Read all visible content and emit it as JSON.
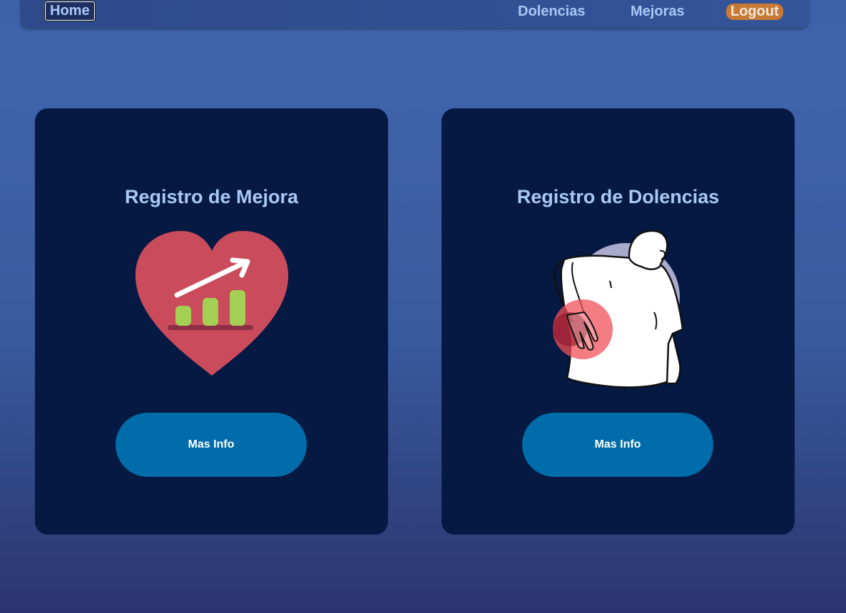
{
  "navbar": {
    "home_label": "Home",
    "dolencias_label": "Dolencias",
    "mejoras_label": "Mejoras",
    "logout_label": "Logout"
  },
  "cards": [
    {
      "title": "Registro de Mejora",
      "button_label": "Mas Info",
      "illustration": "heart-growth-chart-icon"
    },
    {
      "title": "Registro de Dolencias",
      "button_label": "Mas Info",
      "illustration": "back-pain-person-icon"
    }
  ],
  "colors": {
    "nav_text": "#a9c8f5",
    "logout_bg": "#c77a35",
    "card_bg": "#051942",
    "button_bg": "#006ca9",
    "heart": "#c94b5c",
    "bars": "#a3cf52",
    "pain_spot": "#f0505a"
  }
}
